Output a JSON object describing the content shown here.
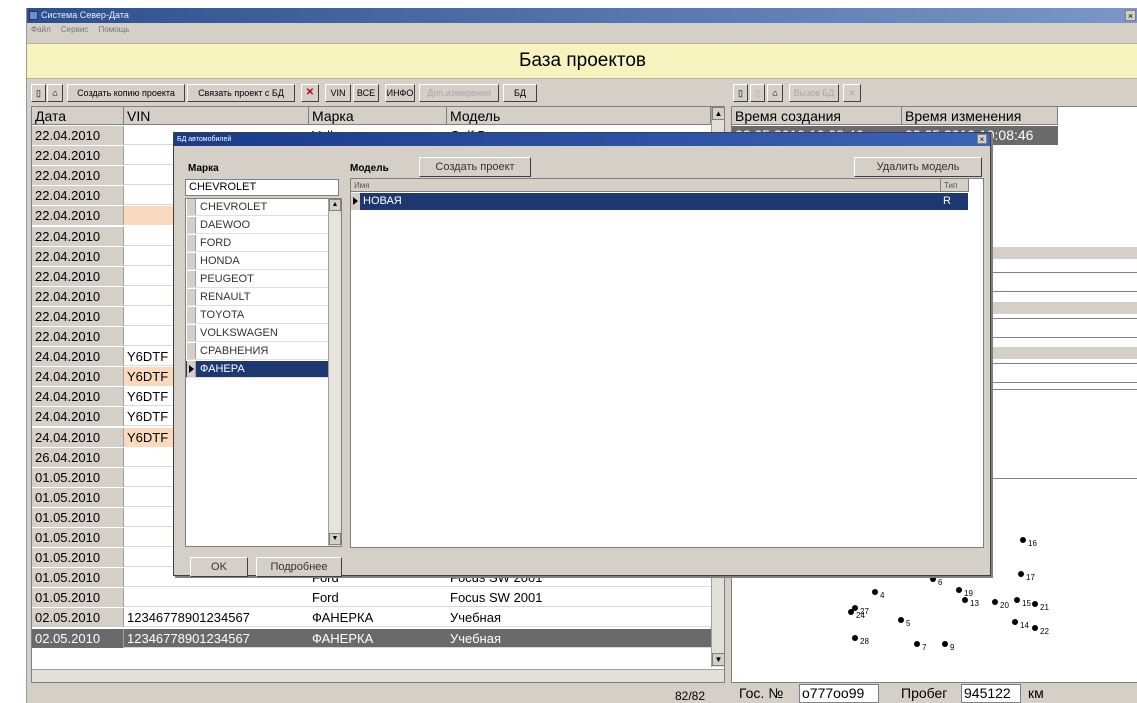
{
  "window": {
    "title": "Система Север-Дата"
  },
  "menu": [
    "Файл",
    "Сервис",
    "Помощь"
  ],
  "banner": "База проектов",
  "toolbar": {
    "copy_project": "Создать копию проекта",
    "link_project": "Связать проект с БД",
    "vin": "VIN",
    "all": "ВСЕ",
    "info": "ИНФО",
    "extra_measure": "Доп.измерения",
    "db": "БД"
  },
  "right_toolbar": {
    "call_db": "Вызов БД"
  },
  "grid": {
    "headers": [
      "Дата",
      "VIN",
      "Марка",
      "Модель"
    ],
    "rows": [
      {
        "date": "22.04.2010",
        "vin": "",
        "make": "Volkswagen",
        "model": "Golf 5"
      },
      {
        "date": "22.04.2010",
        "vin": "",
        "make": "",
        "model": ""
      },
      {
        "date": "22.04.2010",
        "vin": "",
        "make": "",
        "model": ""
      },
      {
        "date": "22.04.2010",
        "vin": "",
        "make": "",
        "model": ""
      },
      {
        "date": "22.04.2010",
        "vin": "",
        "make": "",
        "model": ""
      },
      {
        "date": "22.04.2010",
        "vin": "",
        "make": "",
        "model": ""
      },
      {
        "date": "22.04.2010",
        "vin": "",
        "make": "",
        "model": ""
      },
      {
        "date": "22.04.2010",
        "vin": "",
        "make": "",
        "model": ""
      },
      {
        "date": "22.04.2010",
        "vin": "",
        "make": "",
        "model": ""
      },
      {
        "date": "22.04.2010",
        "vin": "",
        "make": "",
        "model": ""
      },
      {
        "date": "22.04.2010",
        "vin": "",
        "make": "",
        "model": ""
      },
      {
        "date": "24.04.2010",
        "vin": "Y6DTF",
        "make": "",
        "model": ""
      },
      {
        "date": "24.04.2010",
        "vin": "Y6DTF",
        "make": "",
        "model": ""
      },
      {
        "date": "24.04.2010",
        "vin": "Y6DTF",
        "make": "",
        "model": ""
      },
      {
        "date": "24.04.2010",
        "vin": "Y6DTF",
        "make": "",
        "model": ""
      },
      {
        "date": "24.04.2010",
        "vin": "Y6DTF",
        "make": "",
        "model": ""
      },
      {
        "date": "26.04.2010",
        "vin": "",
        "make": "",
        "model": ""
      },
      {
        "date": "01.05.2010",
        "vin": "",
        "make": "",
        "model": ""
      },
      {
        "date": "01.05.2010",
        "vin": "",
        "make": "",
        "model": ""
      },
      {
        "date": "01.05.2010",
        "vin": "",
        "make": "",
        "model": ""
      },
      {
        "date": "01.05.2010",
        "vin": "",
        "make": "",
        "model": ""
      },
      {
        "date": "01.05.2010",
        "vin": "",
        "make": "",
        "model": ""
      },
      {
        "date": "01.05.2010",
        "vin": "",
        "make": "Ford",
        "model": "Focus SW 2001"
      },
      {
        "date": "01.05.2010",
        "vin": "",
        "make": "Ford",
        "model": "Focus SW 2001"
      },
      {
        "date": "02.05.2010",
        "vin": "12346778901234567",
        "make": "ФАНЕРКА",
        "model": "Учебная"
      },
      {
        "date": "02.05.2010",
        "vin": "12346778901234567",
        "make": "ФАНЕРКА",
        "model": "Учебная"
      }
    ],
    "count": "82/82"
  },
  "right_grid": {
    "headers": [
      "Время создания",
      "Время изменения"
    ],
    "row": {
      "created": "02.05.2010 10:08:46",
      "modified": "02.05.2010 10:08:46"
    }
  },
  "points": [
    "4",
    "6",
    "13",
    "14",
    "15",
    "16",
    "17",
    "19",
    "20",
    "21",
    "22",
    "24",
    "27",
    "28",
    "5",
    "7",
    "9"
  ],
  "status": {
    "plate_label": "Гос. №",
    "plate_value": "о777оо99",
    "mileage_label": "Пробег",
    "mileage_value": "945122",
    "mileage_unit": "км"
  },
  "dialog": {
    "title": "БД автомобилей",
    "make_label": "Марка",
    "model_label": "Модель",
    "create_project": "Создать проект",
    "delete_model": "Удалить модель",
    "make_input": "CHEVROLET",
    "makes": [
      "CHEVROLET",
      "DAEWOO",
      "FORD",
      "HONDA",
      "PEUGEOT",
      "RENAULT",
      "TOYOTA",
      "VOLKSWAGEN",
      "СРАВНЕНИЯ",
      "ФАНЕРА"
    ],
    "model_headers": [
      "Имя",
      "Тип"
    ],
    "model_row": {
      "name": "НОВАЯ",
      "type": "R"
    },
    "ok": "OK",
    "details": "Подробнее"
  }
}
